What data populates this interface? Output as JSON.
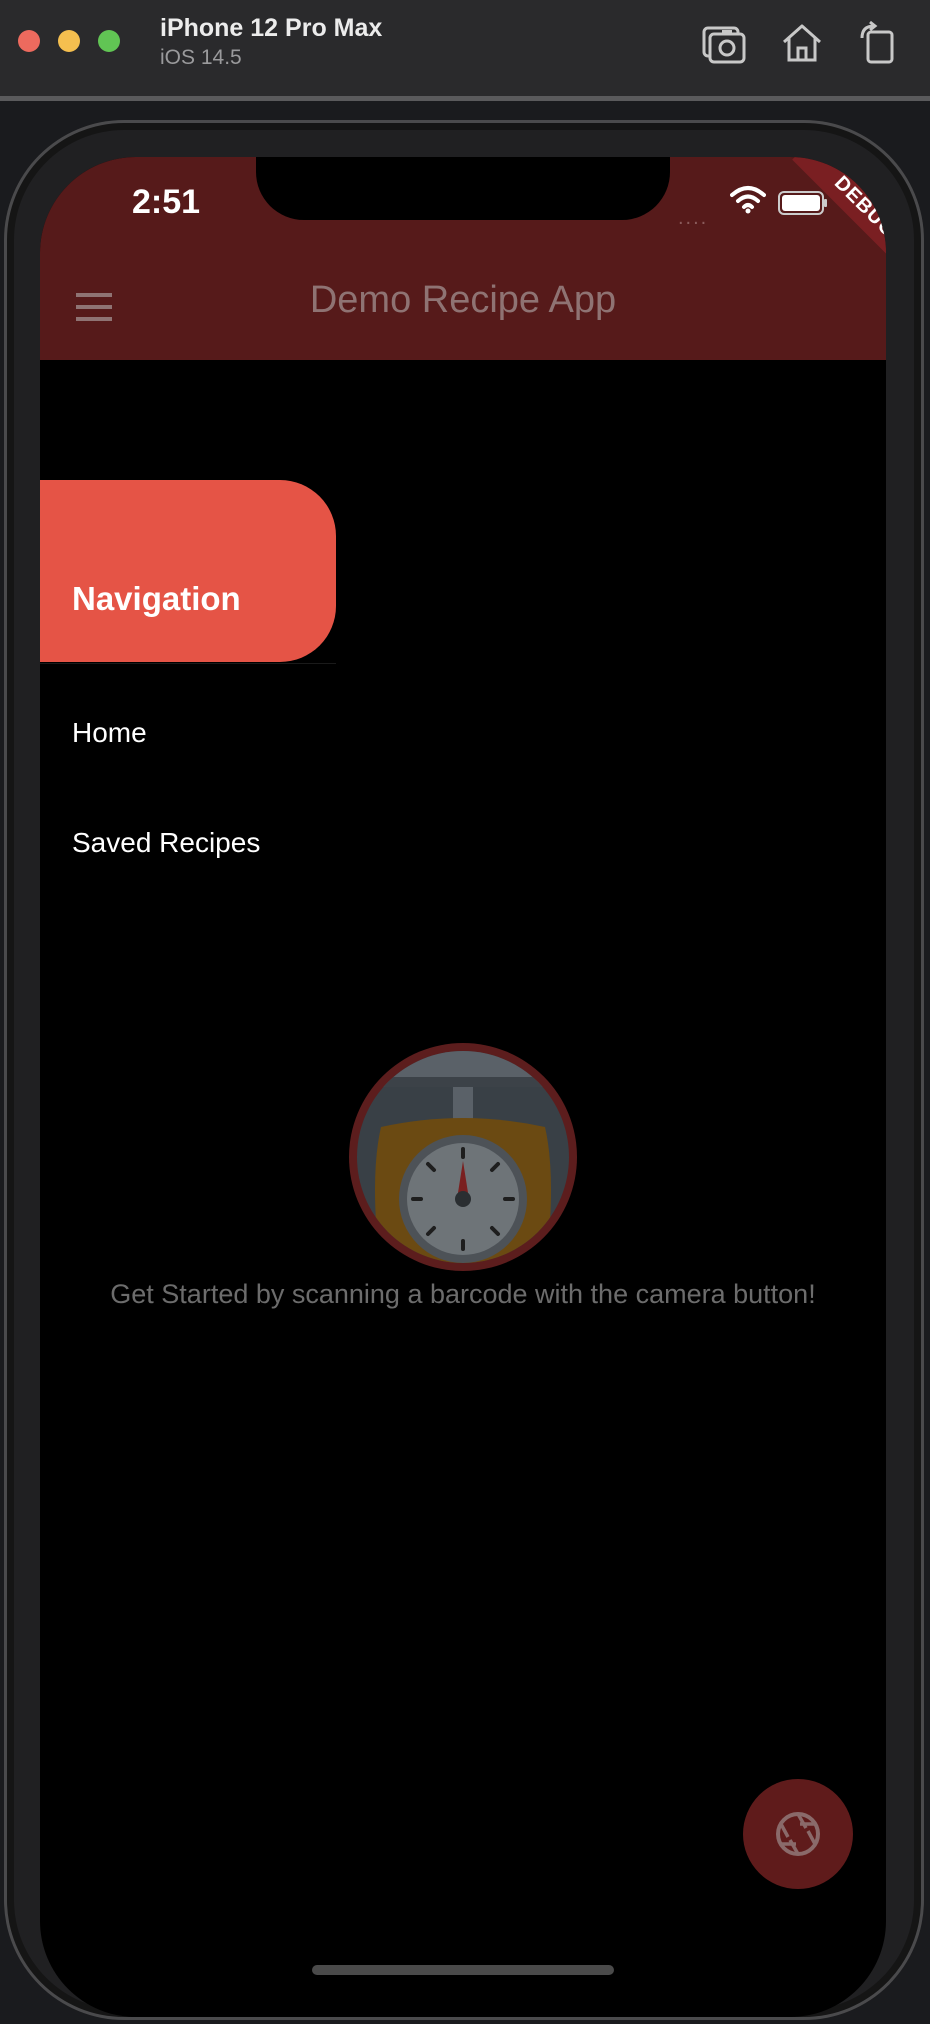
{
  "simulator": {
    "device_name": "iPhone 12 Pro Max",
    "os_version": "iOS 14.5",
    "icons": [
      "screenshot-icon",
      "home-icon",
      "rotate-icon"
    ]
  },
  "status_bar": {
    "time": "2:51",
    "dots": "....",
    "icons": [
      "wifi-icon",
      "battery-icon"
    ]
  },
  "debug_banner": "DEBUG",
  "app_bar": {
    "title": "Demo Recipe App",
    "menu_icon": "hamburger-menu-icon",
    "color": "#561a1a"
  },
  "drawer": {
    "header_title": "Navigation",
    "header_color": "#e55446",
    "items": [
      {
        "label": "Home"
      },
      {
        "label": "Saved Recipes"
      }
    ]
  },
  "empty_state": {
    "illustration": "kitchen-scale-icon",
    "message": "Get Started by scanning a barcode with the camera button!"
  },
  "fab": {
    "icon": "camera-aperture-icon",
    "color": "#5f1b1b"
  }
}
